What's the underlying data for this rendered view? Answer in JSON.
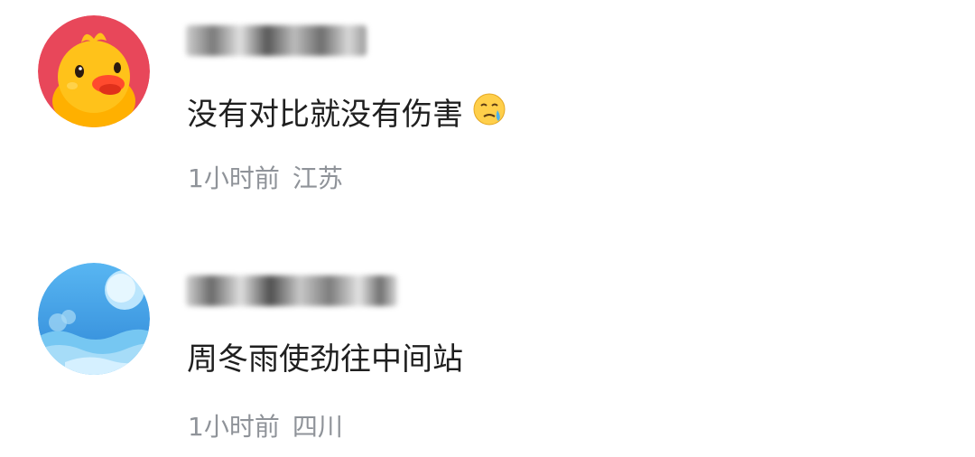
{
  "comments": [
    {
      "avatar_icon": "duck-avatar-icon",
      "username_blurred": true,
      "text": "没有对比就没有伤害",
      "emoji_icon": "crying-face-emoji",
      "time": "1小时前",
      "location": "江苏"
    },
    {
      "avatar_icon": "landscape-avatar-icon",
      "username_blurred": true,
      "text": "周冬雨使劲往中间站",
      "time": "1小时前",
      "location": "四川"
    }
  ],
  "colors": {
    "text": "#1f1f1f",
    "meta": "#8f9399",
    "duck_avatar_bg": "#e8475a",
    "duck_body": "#ffc21a",
    "landscape_avatar_bg": "#3f9be0"
  }
}
